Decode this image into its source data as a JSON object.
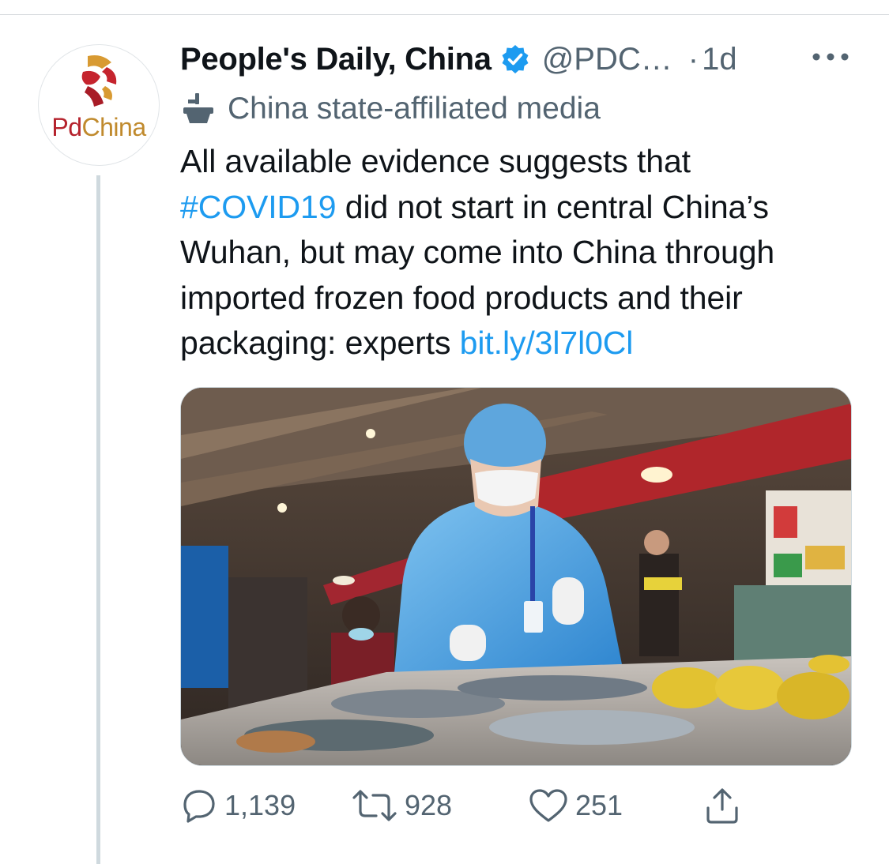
{
  "author": {
    "display_name": "People's Daily, China",
    "handle": "@PDC…",
    "time_sep": "·",
    "time": "1d",
    "avatar_text_1": "Pd",
    "avatar_text_2": "China",
    "state_label": "China state-affiliated media"
  },
  "tweet": {
    "line1": "All available evidence suggests that",
    "hashtag": "#COVID19",
    "line2_rest": " did not start in central China’s",
    "line3": "Wuhan, but may come into China through",
    "line4": "imported frozen food products and their",
    "line5_pre": "packaging: experts ",
    "link": "bit.ly/3l7l0Cl"
  },
  "actions": {
    "replies": "1,139",
    "retweets": "928",
    "likes": "251"
  },
  "colors": {
    "link": "#1d9bf0",
    "secondary_text": "#536471",
    "brand_red": "#b5232d",
    "brand_gold": "#c08a2d"
  },
  "icons": [
    "verified-badge-icon",
    "more-options-icon",
    "state-media-icon",
    "reply-icon",
    "retweet-icon",
    "like-icon",
    "share-icon"
  ]
}
